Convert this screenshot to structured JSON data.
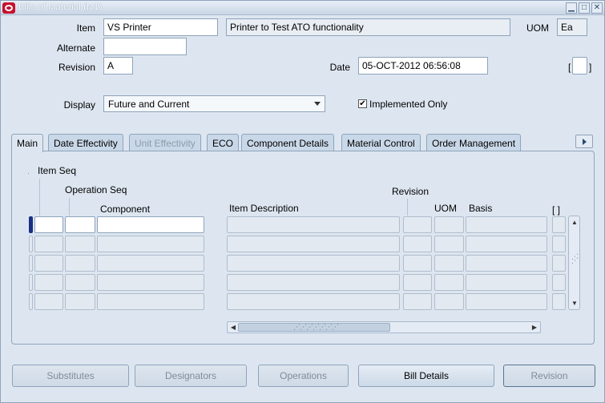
{
  "window": {
    "title": "Bills of Material (M1)",
    "minimize": "▁",
    "maximize": "□",
    "close": "✕"
  },
  "header": {
    "item_label": "Item",
    "item_value": "VS Printer",
    "item_description": "Printer to Test ATO functionality",
    "uom_label": "UOM",
    "uom_value": "Ea",
    "alternate_label": "Alternate",
    "alternate_value": "",
    "revision_label": "Revision",
    "revision_value": "A",
    "date_label": "Date",
    "date_value": "05-OCT-2012 06:56:08",
    "flex_open": "[",
    "flex_close": "]",
    "display_label": "Display",
    "display_value": "Future and Current",
    "implemented_only_label": "Implemented Only",
    "implemented_only_checked": true,
    "check_mark": "✔"
  },
  "tabs": [
    {
      "label": "Main",
      "state": "active"
    },
    {
      "label": "Date Effectivity",
      "state": "enabled"
    },
    {
      "label": "Unit Effectivity",
      "state": "disabled"
    },
    {
      "label": "ECO",
      "state": "enabled"
    },
    {
      "label": "Component Details",
      "state": "enabled"
    },
    {
      "label": "Material Control",
      "state": "enabled"
    },
    {
      "label": "Order Management",
      "state": "enabled"
    }
  ],
  "grid": {
    "headers": {
      "item_seq": "Item Seq",
      "operation_seq": "Operation Seq",
      "component": "Component",
      "item_description": "Item Description",
      "revision": "Revision",
      "uom": "UOM",
      "basis": "Basis",
      "flex": "[ ]"
    },
    "rows": [
      {
        "item_seq": "",
        "operation_seq": "",
        "component": "",
        "item_description": "",
        "revision": "",
        "uom": "",
        "basis": ""
      },
      {
        "item_seq": "",
        "operation_seq": "",
        "component": "",
        "item_description": "",
        "revision": "",
        "uom": "",
        "basis": ""
      },
      {
        "item_seq": "",
        "operation_seq": "",
        "component": "",
        "item_description": "",
        "revision": "",
        "uom": "",
        "basis": ""
      },
      {
        "item_seq": "",
        "operation_seq": "",
        "component": "",
        "item_description": "",
        "revision": "",
        "uom": "",
        "basis": ""
      },
      {
        "item_seq": "",
        "operation_seq": "",
        "component": "",
        "item_description": "",
        "revision": "",
        "uom": "",
        "basis": ""
      }
    ]
  },
  "buttons": {
    "substitutes": "Substitutes",
    "designators": "Designators",
    "operations": "Operations",
    "bill_details": "Bill Details",
    "revision": "Revision"
  },
  "colors": {
    "window_bg": "#dde6f0",
    "title_text": "#ffffff",
    "current_row_indicator": "#1a2e86",
    "oracle_logo": "#c8102e"
  }
}
